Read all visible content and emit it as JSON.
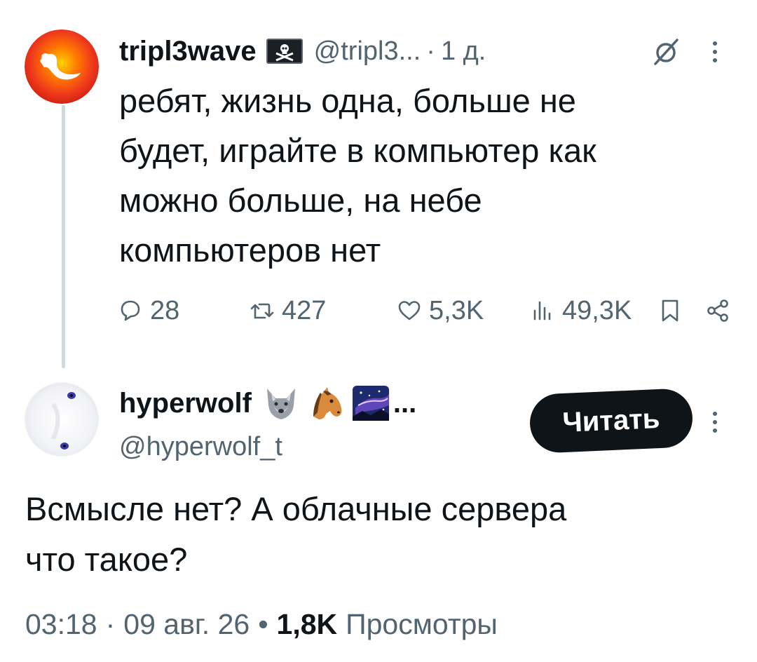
{
  "tweet": {
    "author_name": "tripl3wave",
    "author_flag_icon": "pirate-flag-icon",
    "handle": "@tripl3...",
    "separator": "·",
    "time_ago": "1 д.",
    "text": "ребят, жизнь одна, больше не\nбудет, играйте в компьютер как\nможно больше, на небе\nкомпьютеров нет",
    "replies": "28",
    "retweets": "427",
    "likes": "5,3K",
    "views": "49,3K"
  },
  "reply": {
    "author_name": "hyperwolf",
    "name_emojis": [
      "wolf-emoji",
      "horse-emoji",
      "night-sky-emoji"
    ],
    "name_ellipsis": "...",
    "handle": "@hyperwolf_t",
    "follow_label": "Читать",
    "text": "Всмысле нет? А облачные сервера\nчто такое?",
    "time": "03:18",
    "sep1": "·",
    "date": "09 авг. 26",
    "sep2": "•",
    "views_count": "1,8K",
    "views_label": "Просмотры"
  },
  "colors": {
    "text": "#0f1419",
    "muted": "#536471",
    "thread_line": "#cfd9de",
    "button_bg": "#0f1419",
    "button_text": "#ffffff"
  }
}
